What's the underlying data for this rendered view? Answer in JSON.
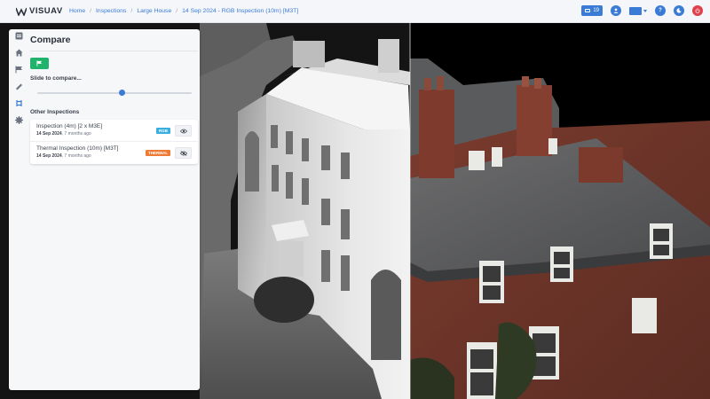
{
  "app": {
    "logo_text": "VISUAV"
  },
  "breadcrumb": [
    {
      "label": "Home"
    },
    {
      "label": "Inspections"
    },
    {
      "label": "Large House"
    },
    {
      "label": "14 Sep 2024 - RGB Inspection (10m) [M3T]"
    }
  ],
  "topbar": {
    "messages_count": "19",
    "icons": [
      "envelope-icon",
      "user-icon",
      "id-card-icon",
      "help-icon",
      "moon-icon",
      "power-icon"
    ]
  },
  "nav": [
    "dashboard-icon",
    "home-icon",
    "flag-icon",
    "ruler-icon",
    "compare-icon",
    "settings-icon"
  ],
  "panel": {
    "title": "Compare",
    "slide_label": "Slide to compare...",
    "slider_value": 0.55,
    "other_label": "Other Inspections",
    "inspections": [
      {
        "name": "Inspection (4m) [2 x M3E]",
        "date": "14 Sep 2024",
        "ago": ", 7 months ago",
        "tag": "RGB",
        "tag_color": "#3aaee0",
        "visible": true
      },
      {
        "name": "Thermal Inspection (10m) [M3T]",
        "date": "14 Sep 2024",
        "ago": ", 7 months ago",
        "tag": "THERMAL",
        "tag_color": "#ef7a35",
        "visible": false
      }
    ]
  },
  "colors": {
    "accent": "#3a7bd5",
    "success": "#21b36b",
    "danger": "#e0404a"
  }
}
